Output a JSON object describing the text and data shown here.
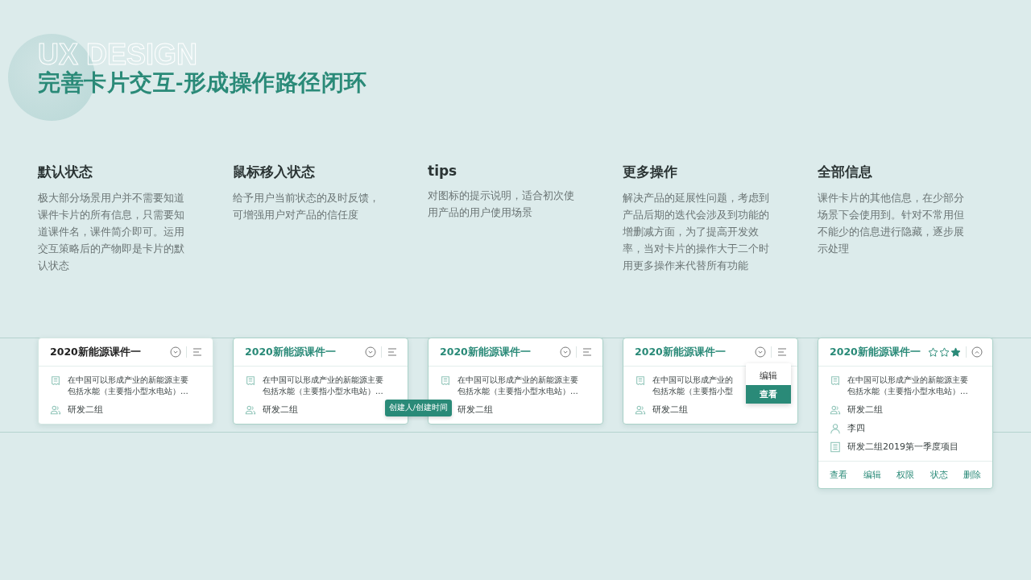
{
  "background_text": "UX DESIGN",
  "title": "完善卡片交互-形成操作路径闭环",
  "sections": [
    {
      "heading": "默认状态",
      "description": "极大部分场景用户并不需要知道课件卡片的所有信息，只需要知道课件名，课件简介即可。运用交互策略后的产物即是卡片的默认状态",
      "card": {
        "title": "2020新能源课件一",
        "hovered": false,
        "expanded": false,
        "summary": [
          "在中国可以形成产业的新能源主要",
          "包括水能（主要指小型水电站）..."
        ],
        "group": "研发二组"
      }
    },
    {
      "heading": "鼠标移入状态",
      "description": "给予用户当前状态的及时反馈，可增强用户对产品的信任度",
      "card": {
        "title": "2020新能源课件一",
        "hovered": true,
        "expanded": false,
        "summary": [
          "在中国可以形成产业的新能源主要",
          "包括水能（主要指小型水电站）..."
        ],
        "group": "研发二组"
      }
    },
    {
      "heading": "tips",
      "description": "对图标的提示说明，适合初次使用产品的用户使用场景",
      "card": {
        "title": "2020新能源课件一",
        "hovered": true,
        "expanded": false,
        "summary": [
          "在中国可以形成产业的新能源主要",
          "包括水能（主要指小型水电站）..."
        ],
        "group": "研发二组",
        "tooltip": "创建人/创建时间"
      }
    },
    {
      "heading": "更多操作",
      "description": "解决产品的延展性问题，考虑到产品后期的迭代会涉及到功能的增删减方面，为了提高开发效率，当对卡片的操作大于二个时用更多操作来代替所有功能",
      "card": {
        "title": "2020新能源课件一",
        "hovered": true,
        "expanded": false,
        "summary": [
          "在中国可以形成产业的",
          "包括水能（主要指小型"
        ],
        "group": "研发二组",
        "menu": [
          {
            "label": "编辑",
            "selected": false
          },
          {
            "label": "查看",
            "selected": true
          }
        ]
      }
    },
    {
      "heading": "全部信息",
      "description": "课件卡片的其他信息，在少部分场景下会使用到。针对不常用但不能少的信息进行隐藏，逐步展示处理",
      "card": {
        "title": "2020新能源课件一",
        "hovered": true,
        "expanded": true,
        "stars": 1,
        "summary": [
          "在中国可以形成产业的新能源主要",
          "包括水能（主要指小型水电站）..."
        ],
        "group": "研发二组",
        "owner": "李四",
        "project": "研发二组2019第一季度项目",
        "actions": [
          "查看",
          "编辑",
          "权限",
          "状态",
          "删除"
        ]
      }
    }
  ]
}
